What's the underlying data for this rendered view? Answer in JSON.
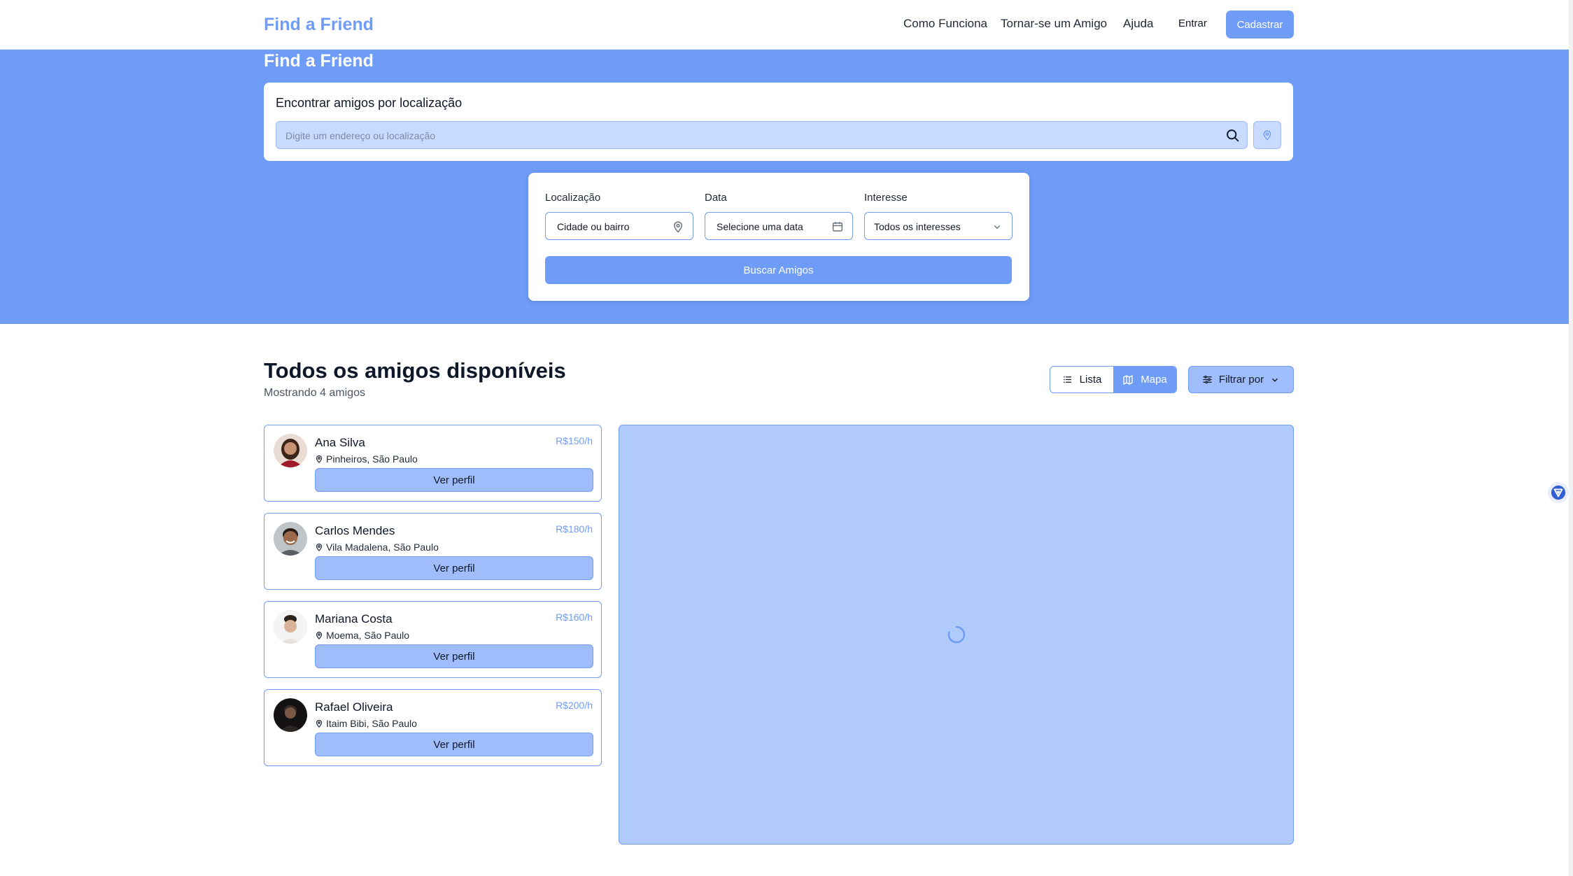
{
  "header": {
    "brand": "Find a Friend",
    "nav": [
      "Como Funciona",
      "Tornar-se um Amigo",
      "Ajuda"
    ],
    "login_label": "Entrar",
    "signup_label": "Cadastrar"
  },
  "hero": {
    "title": "Find a Friend",
    "search_title": "Encontrar amigos por localização",
    "search_placeholder": "Digite um endereço ou localização",
    "filters": {
      "location_label": "Localização",
      "location_value": "Cidade ou bairro",
      "date_label": "Data",
      "date_value": "Selecione uma data",
      "interest_label": "Interesse",
      "interest_value": "Todos os interesses",
      "submit_label": "Buscar Amigos"
    }
  },
  "results": {
    "title": "Todos os amigos disponíveis",
    "subtitle": "Mostrando 4 amigos",
    "view_list_label": "Lista",
    "view_map_label": "Mapa",
    "active_view": "map",
    "filter_label": "Filtrar por",
    "friends": [
      {
        "name": "Ana Silva",
        "location": "Pinheiros, São Paulo",
        "price": "R$150/h",
        "button": "Ver perfil"
      },
      {
        "name": "Carlos Mendes",
        "location": "Vila Madalena, São Paulo",
        "price": "R$180/h",
        "button": "Ver perfil"
      },
      {
        "name": "Mariana Costa",
        "location": "Moema, São Paulo",
        "price": "R$160/h",
        "button": "Ver perfil"
      },
      {
        "name": "Rafael Oliveira",
        "location": "Itaim Bibi, São Paulo",
        "price": "R$200/h",
        "button": "Ver perfil"
      }
    ]
  },
  "colors": {
    "primary": "#6e9cf7",
    "light": "#9fbdfa",
    "input_bg": "#c8dafd",
    "map_bg": "#b0cbfb"
  }
}
